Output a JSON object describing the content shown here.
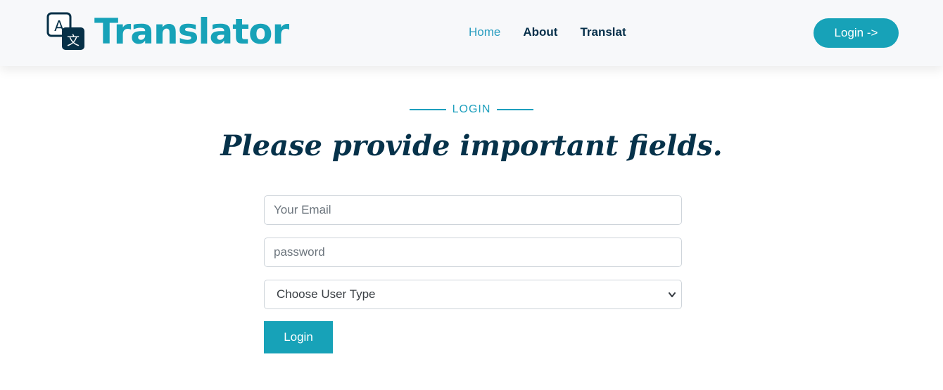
{
  "brand": {
    "name": "Translator",
    "icon": "translate-icon",
    "color": "#17a2b8"
  },
  "nav": {
    "items": [
      {
        "label": "Home",
        "active": true
      },
      {
        "label": "About",
        "active": false
      },
      {
        "label": "Translat",
        "active": false
      }
    ],
    "login_button": "Login ->"
  },
  "section": {
    "label": "LOGIN",
    "heading": "Please provide important fields."
  },
  "form": {
    "email_placeholder": "Your Email",
    "password_placeholder": "password",
    "user_type_selected": "Choose User Type",
    "submit_label": "Login"
  },
  "colors": {
    "accent": "#17a2b8",
    "heading": "#06324a"
  }
}
